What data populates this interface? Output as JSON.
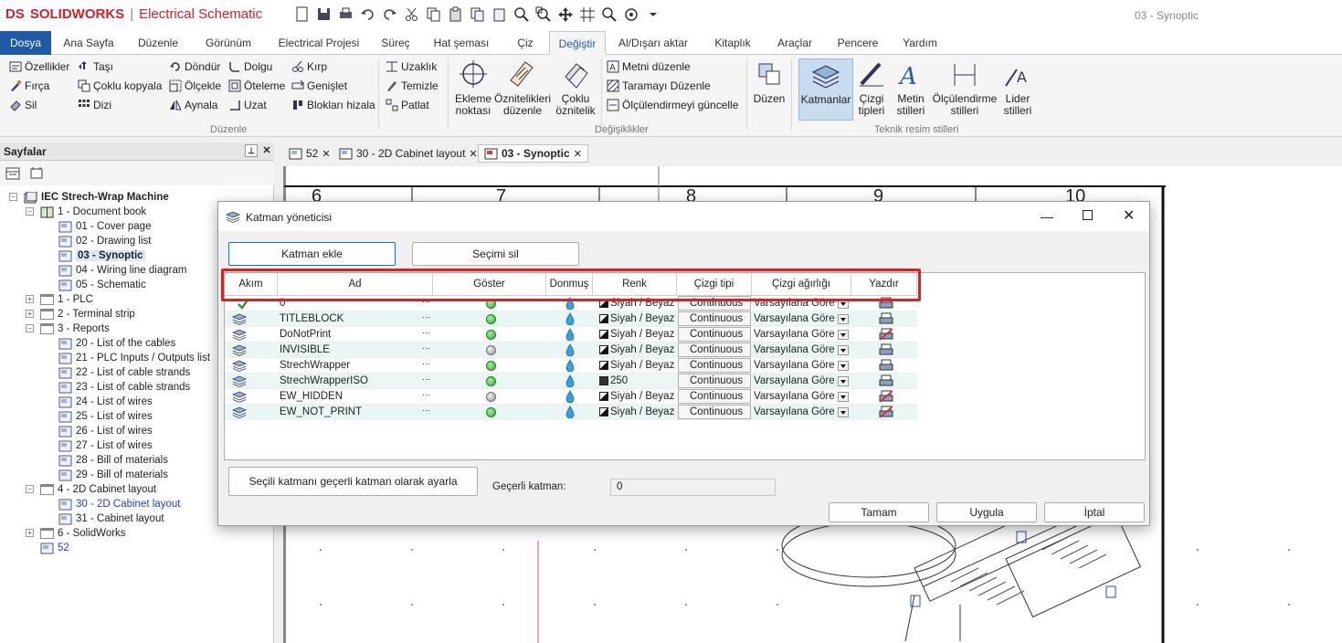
{
  "app": {
    "logo_ds": "DS",
    "brand": "SOLIDWORKS",
    "separator": "|",
    "product": "Electrical Schematic",
    "document_title": "03 - Synoptic"
  },
  "quick_access": [
    "new-icon",
    "save-icon",
    "print-icon",
    "undo-icon",
    "redo-icon",
    "cut-icon",
    "copy-icon",
    "paste-icon",
    "page-copy-icon",
    "page-paste-icon",
    "zoom-icon",
    "zoom-window-icon",
    "pan-icon",
    "grid-icon",
    "search-icon",
    "options-icon",
    "dropdown-icon"
  ],
  "tabs": [
    "Dosya",
    "Ana Sayfa",
    "Düzenle",
    "Görünüm",
    "Electrical Projesi",
    "Süreç",
    "Hat şeması",
    "Çiz",
    "Değiştir",
    "Al/Dışarı aktar",
    "Kitaplık",
    "Araçlar",
    "Pencere",
    "Yardım"
  ],
  "ribbon": {
    "col1": [
      "Özellikler",
      "Fırça",
      "Sil"
    ],
    "col2": [
      "Taşı",
      "Çoklu kopyala",
      "Dizi"
    ],
    "col3": [
      "Döndür",
      "Ölçekle",
      "Aynala"
    ],
    "col4": [
      "Dolgu",
      "Öteleme",
      "Uzat"
    ],
    "col5": [
      "Kırp",
      "Genişlet",
      "Blokları hizala"
    ],
    "col6": [
      "Uzaklık",
      "Temizle",
      "Patlat"
    ],
    "big1": [
      {
        "l1": "Ekleme",
        "l2": "noktası"
      },
      {
        "l1": "Öznitelikleri",
        "l2": "düzenle"
      },
      {
        "l1": "Çoklu",
        "l2": "öznitelik"
      }
    ],
    "col7": [
      "Metni düzenle",
      "Taramayı Düzenle",
      "Ölçülendirmeyi güncelle"
    ],
    "big2": [
      {
        "l1": "Düzen",
        "l2": ""
      },
      {
        "l1": "Katmanlar",
        "l2": ""
      },
      {
        "l1": "Çizgi",
        "l2": "tipleri"
      },
      {
        "l1": "Metin",
        "l2": "stilleri"
      },
      {
        "l1": "Ölçülendirme",
        "l2": "stilleri"
      },
      {
        "l1": "Lider",
        "l2": "stilleri"
      }
    ],
    "groups": [
      "Düzenle",
      "Değişiklikler",
      "Teknik resim stilleri"
    ]
  },
  "panel": {
    "title": "Sayfalar",
    "pin": "ᵖ",
    "close": "✕"
  },
  "tree": [
    {
      "label": "IEC Strech-Wrap Machine",
      "bold": true
    },
    {
      "label": "1 - Document book"
    },
    {
      "label": "01 - Cover page"
    },
    {
      "label": "02 - Drawing list"
    },
    {
      "label": "03 - Synoptic",
      "selected": true
    },
    {
      "label": "04 - Wiring line diagram"
    },
    {
      "label": "05 - Schematic"
    },
    {
      "label": "1 - PLC"
    },
    {
      "label": "2 - Terminal strip"
    },
    {
      "label": "3 - Reports"
    },
    {
      "label": "20 - List of the cables"
    },
    {
      "label": "21 - PLC Inputs / Outputs list"
    },
    {
      "label": "22 - List of cable strands"
    },
    {
      "label": "23 - List of cable strands"
    },
    {
      "label": "24 - List of wires"
    },
    {
      "label": "25 - List of wires"
    },
    {
      "label": "26 - List of wires"
    },
    {
      "label": "27 - List of wires"
    },
    {
      "label": "28 - Bill of materials"
    },
    {
      "label": "29 - Bill of materials"
    },
    {
      "label": "4 - 2D Cabinet layout"
    },
    {
      "label": "30 - 2D Cabinet layout",
      "link": true
    },
    {
      "label": "31 - Cabinet layout"
    },
    {
      "label": "6 - SolidWorks"
    },
    {
      "label": "52",
      "link": true
    }
  ],
  "doc_tabs": [
    "52",
    "30 - 2D Cabinet layout",
    "03 - Synoptic"
  ],
  "drawing": {
    "columns": [
      "6",
      "7",
      "8",
      "9",
      "10"
    ]
  },
  "dialog": {
    "title": "Katman yöneticisi",
    "add_layer": "Katman ekle",
    "delete_selection": "Seçimi sil",
    "columns": [
      "Akım",
      "Ad",
      "Göster",
      "Donmuş",
      "Renk",
      "Çizgi tipi",
      "Çizgi ağırlığı",
      "Yazdır"
    ],
    "rows": [
      {
        "name": "0",
        "show": true,
        "color": "Siyah / Beyaz",
        "linetype": "Continuous",
        "weight": "Varsayılana Göre",
        "print": true,
        "current": true
      },
      {
        "name": "TITLEBLOCK",
        "show": true,
        "color": "Siyah / Beyaz",
        "linetype": "Continuous",
        "weight": "Varsayılana Göre",
        "print": true
      },
      {
        "name": "DoNotPrint",
        "show": true,
        "color": "Siyah / Beyaz",
        "linetype": "Continuous",
        "weight": "Varsayılana Göre",
        "print": false
      },
      {
        "name": "INVISIBLE",
        "show": false,
        "color": "Siyah / Beyaz",
        "linetype": "Continuous",
        "weight": "Varsayılana Göre",
        "print": true
      },
      {
        "name": "StrechWrapper",
        "show": true,
        "color": "Siyah / Beyaz",
        "linetype": "Continuous",
        "weight": "Varsayılana Göre",
        "print": true
      },
      {
        "name": "StrechWrapperISO",
        "show": true,
        "color": "250",
        "linetype": "Continuous",
        "weight": "Varsayılana Göre",
        "print": true
      },
      {
        "name": "EW_HIDDEN",
        "show": false,
        "color": "Siyah / Beyaz",
        "linetype": "Continuous",
        "weight": "Varsayılana Göre",
        "print": false
      },
      {
        "name": "EW_NOT_PRINT",
        "show": true,
        "color": "Siyah / Beyaz",
        "linetype": "Continuous",
        "weight": "Varsayılana Göre",
        "print": false
      }
    ],
    "set_current": "Seçili katmanı geçerli katman olarak ayarla",
    "current_layer_label": "Geçerli katman:",
    "current_layer_value": "0",
    "ok": "Tamam",
    "apply": "Uygula",
    "cancel": "İptal"
  },
  "colors": {
    "accent": "#1e5aa8",
    "brand_red": "#d0202e",
    "highlight": "#e02020"
  }
}
